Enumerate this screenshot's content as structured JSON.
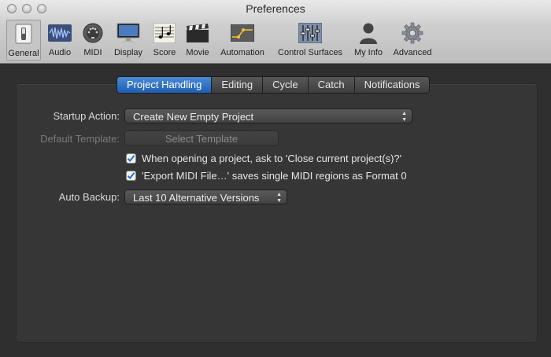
{
  "window": {
    "title": "Preferences"
  },
  "toolbar": {
    "items": [
      {
        "label": "General",
        "icon": "general-switch-icon"
      },
      {
        "label": "Audio",
        "icon": "audio-waveform-icon"
      },
      {
        "label": "MIDI",
        "icon": "midi-connector-icon"
      },
      {
        "label": "Display",
        "icon": "monitor-icon"
      },
      {
        "label": "Score",
        "icon": "score-notes-icon"
      },
      {
        "label": "Movie",
        "icon": "film-clapper-icon"
      },
      {
        "label": "Automation",
        "icon": "automation-curve-icon"
      },
      {
        "label": "Control Surfaces",
        "icon": "control-surfaces-faders-icon"
      },
      {
        "label": "My Info",
        "icon": "user-silhouette-icon"
      },
      {
        "label": "Advanced",
        "icon": "gear-icon"
      }
    ]
  },
  "tabs": [
    {
      "label": "Project Handling",
      "active": true
    },
    {
      "label": "Editing"
    },
    {
      "label": "Cycle"
    },
    {
      "label": "Catch"
    },
    {
      "label": "Notifications"
    }
  ],
  "form": {
    "startup_label": "Startup Action:",
    "startup_value": "Create New Empty Project",
    "default_template_label": "Default Template:",
    "select_template_button": "Select Template",
    "close_project_check": "When opening a project, ask to 'Close current project(s)?'",
    "export_midi_check": "'Export MIDI File…' saves single MIDI regions as Format 0",
    "auto_backup_label": "Auto Backup:",
    "auto_backup_value": "Last 10 Alternative Versions"
  },
  "colors": {
    "accent": "#2a6fc8",
    "panel": "#363636"
  }
}
